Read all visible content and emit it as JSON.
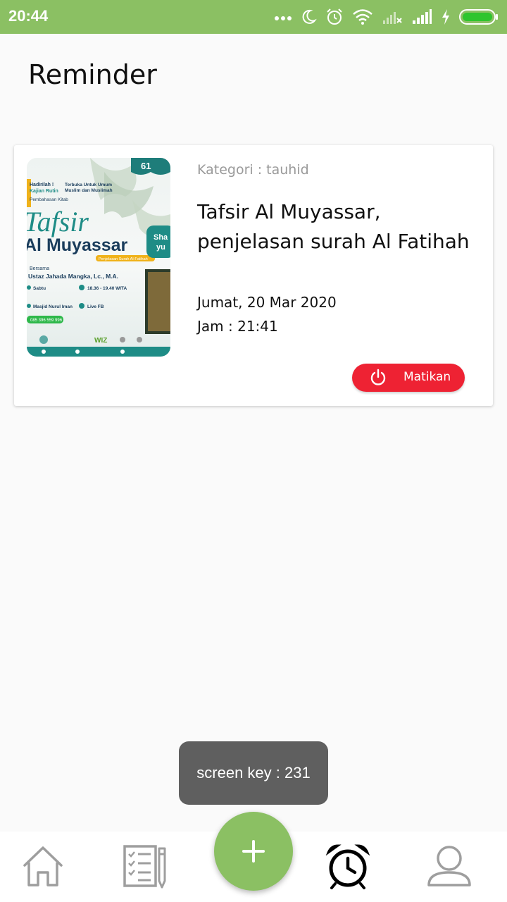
{
  "status_bar": {
    "time": "20:44",
    "icons": [
      "dots-icon",
      "moon-icon",
      "alarm-icon",
      "wifi-icon",
      "signal-off-icon",
      "signal-icon",
      "charging-icon",
      "battery-icon"
    ]
  },
  "page": {
    "title": "Reminder"
  },
  "reminder_card": {
    "category": "Kategori : tauhid",
    "title": "Tafsir Al Muyassar, penjelasan  surah Al Fatihah",
    "date": "Jumat, 20 Mar 2020",
    "time": "Jam : 21:41",
    "off_button_label": "Matikan",
    "poster": {
      "badge": "61",
      "texts": [
        "Hadirilah !",
        "Kajian Rutin",
        "Terbuka Untuk Umum",
        "Muslim dan Muslimah",
        "Pembahasan Kitab",
        "Tafsir",
        "Al Muyassar",
        "Penjelasan Surah Al-Fatihah",
        "Bersama",
        "Ustaz Jahada Mangka, Lc., M.A.",
        "Sabtu",
        "18.36 - 19.40 WITA",
        "Masjid Nurul Iman",
        "Live FB",
        "085 396 559 996",
        "WIZ"
      ]
    }
  },
  "toast": {
    "text": "screen key : 231"
  },
  "bottom_nav": {
    "items": [
      "home-icon",
      "checklist-icon",
      "add-icon",
      "alarm-icon",
      "profile-icon"
    ]
  },
  "colors": {
    "primary": "#8bc063",
    "danger": "#ee2233",
    "toast": "#5f5f5f"
  }
}
